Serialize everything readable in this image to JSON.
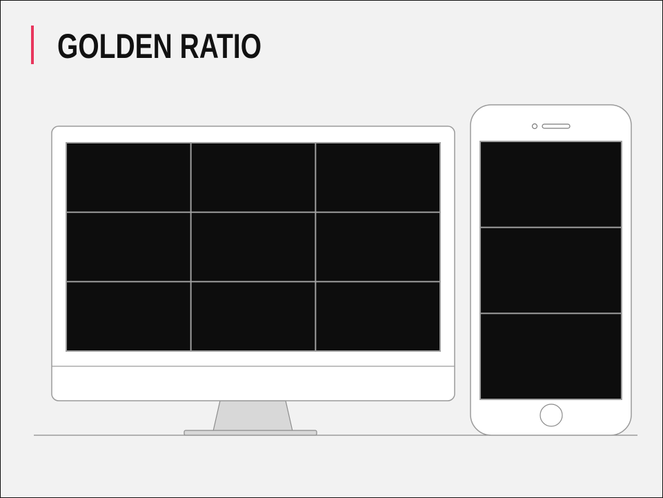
{
  "slide": {
    "title": "GOLDEN RATIO",
    "accent_color": "#e8365d",
    "background_color": "#f2f2f2"
  },
  "devices": {
    "monitor": {
      "grid_rows": 3,
      "grid_cols": 3,
      "screen_color": "#0d0d0d",
      "grid_line_color": "#a0a0a0"
    },
    "phone": {
      "grid_rows": 3,
      "grid_cols": 1,
      "screen_color": "#0d0d0d",
      "grid_line_color": "#a0a0a0"
    }
  }
}
